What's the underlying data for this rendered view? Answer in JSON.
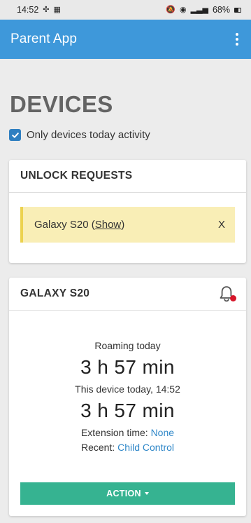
{
  "status_bar": {
    "time": "14:52",
    "battery": "68%"
  },
  "app_bar": {
    "title": "Parent App"
  },
  "page": {
    "title": "DEVICES",
    "filter_label": "Only devices today activity",
    "filter_checked": true
  },
  "unlock_requests": {
    "title": "UNLOCK REQUESTS",
    "item": {
      "device": "Galaxy S20 (",
      "show_label": "Show",
      "close_paren": ")",
      "dismiss_label": "X"
    }
  },
  "device_card": {
    "title": "GALAXY S20",
    "roaming_label": "Roaming today",
    "roaming_value": "3 h 57 min",
    "device_today_label": "This device today, 14:52",
    "device_today_value": "3 h 57 min",
    "extension_label": "Extension time: ",
    "extension_value": "None",
    "recent_label": "Recent: ",
    "recent_value": "Child Control",
    "action_label": "ACTION"
  },
  "colors": {
    "app_bar": "#3e98da",
    "checkbox": "#2f7fc1",
    "request_background": "#f9eeb6",
    "request_accent": "#ecd24f",
    "notification_badge": "#d6162a",
    "link": "#2f87c8",
    "action_button": "#36b391"
  },
  "icons": [
    "mute-icon",
    "wifi-icon",
    "signal-icon",
    "battery-icon",
    "overflow-menu-icon",
    "check-icon",
    "bell-icon",
    "dropdown-caret-icon"
  ]
}
